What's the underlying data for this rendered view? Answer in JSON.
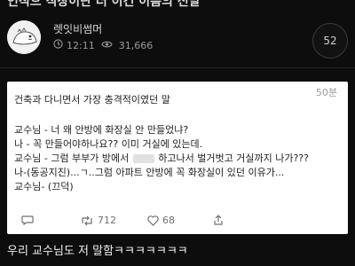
{
  "post": {
    "title_partial": "인적으 직장이란 더 이건 이름의 전말",
    "author": "렛잇비썸머",
    "time": "12:11",
    "views": "31,666",
    "comment_count": "52",
    "caption": "우리 교수님도 저 말함ㅋㅋㅋㅋㅋㅋㅋ"
  },
  "embedded_tweet": {
    "time_ago": "50분",
    "lines": [
      "건축과 다니면서 가장 충격적이였던 말",
      "교수님 - 너 왜 안방에 화장실 안 만들었냐?",
      "나 - 꼭 만들어야하나요?? 이미 거실에 있는데.",
      "교수님 - 그럼 부부가 방에서",
      "하고나서 벌거벗고 거실까지 나가???",
      "나-(동공지진)...ㄱ..그럼 아파트 안방에 꼭 화장실이 있던 이유가...",
      "교수님- (끄덕)"
    ],
    "replies": "",
    "retweets": "712",
    "likes": "68"
  },
  "icons": {
    "eye": "eye-icon",
    "clock": "clock-icon",
    "reply": "reply-icon",
    "retweet": "retweet-icon",
    "like": "heart-icon",
    "share": "share-icon"
  }
}
